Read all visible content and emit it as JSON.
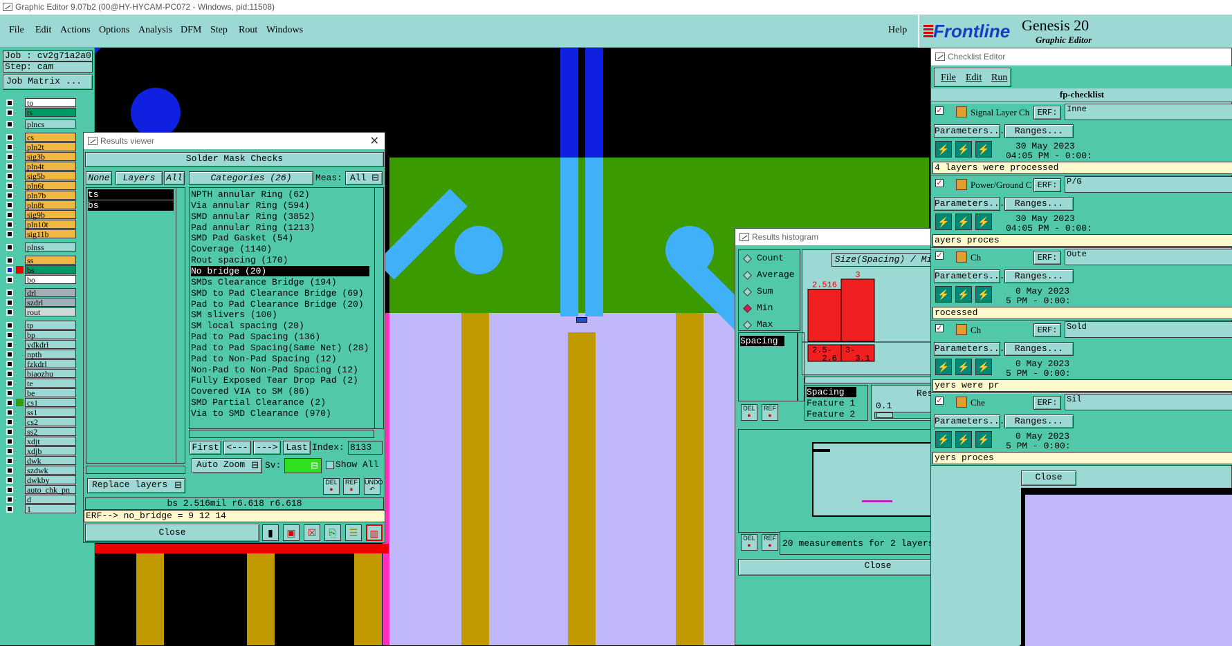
{
  "titlebar": {
    "text": "Graphic Editor 9.07b2 (00@HY-HYCAM-PC072 - Windows, pid:11508)"
  },
  "menu": {
    "items": [
      "File",
      "Edit",
      "Actions",
      "Options",
      "Analysis",
      "DFM",
      "Step",
      "Rout",
      "Windows"
    ],
    "help": "Help"
  },
  "logo": {
    "brand": "Frontline",
    "product": "Genesis 20",
    "subtitle": "Graphic Editor"
  },
  "left": {
    "job": "Job : cv2g71a2a0",
    "step": "Step: cam",
    "job_matrix": "Job Matrix ...",
    "layers": [
      {
        "name": "to",
        "color": "#ffffff"
      },
      {
        "name": "ts",
        "color": "#009966"
      },
      {
        "name": "plncs",
        "color": "#9cd8d4"
      },
      {
        "name": "cs",
        "color": "#f0b840"
      },
      {
        "name": "pln2t",
        "color": "#f0b840"
      },
      {
        "name": "sig3b",
        "color": "#f0b840"
      },
      {
        "name": "pln4t",
        "color": "#f0b840"
      },
      {
        "name": "sig5b",
        "color": "#f0b840"
      },
      {
        "name": "pln6t",
        "color": "#f0b840"
      },
      {
        "name": "pln7b",
        "color": "#f0b840"
      },
      {
        "name": "pln8t",
        "color": "#f0b840"
      },
      {
        "name": "sig9b",
        "color": "#f0b840"
      },
      {
        "name": "pln10t",
        "color": "#f0b840"
      },
      {
        "name": "sig11b",
        "color": "#f0b840"
      },
      {
        "name": "plnss",
        "color": "#9cd8d4"
      },
      {
        "name": "ss",
        "color": "#f0b840"
      },
      {
        "name": "bs",
        "color": "#009966"
      },
      {
        "name": "bo",
        "color": "#ffffff"
      },
      {
        "name": "drl",
        "color": "#a0b0b8"
      },
      {
        "name": "szdrl",
        "color": "#a0b0b8"
      },
      {
        "name": "rout",
        "color": "#d0d8d8"
      },
      {
        "name": "tp",
        "color": "#9cd8d4"
      },
      {
        "name": "bp",
        "color": "#9cd8d4"
      },
      {
        "name": "ydkdrl",
        "color": "#9cd8d4"
      },
      {
        "name": "npth",
        "color": "#9cd8d4"
      },
      {
        "name": "fzkdrl",
        "color": "#9cd8d4"
      },
      {
        "name": "biaozhu",
        "color": "#9cd8d4"
      },
      {
        "name": "te",
        "color": "#9cd8d4"
      },
      {
        "name": "be",
        "color": "#9cd8d4"
      },
      {
        "name": "cs1",
        "color": "#9cd8d4"
      },
      {
        "name": "ss1",
        "color": "#9cd8d4"
      },
      {
        "name": "cs2",
        "color": "#9cd8d4"
      },
      {
        "name": "ss2",
        "color": "#9cd8d4"
      },
      {
        "name": "xdjt",
        "color": "#9cd8d4"
      },
      {
        "name": "xdjb",
        "color": "#9cd8d4"
      },
      {
        "name": "dwk",
        "color": "#9cd8d4"
      },
      {
        "name": "szdwk",
        "color": "#9cd8d4"
      },
      {
        "name": "dwkby",
        "color": "#9cd8d4"
      },
      {
        "name": "auto_chk_pn",
        "color": "#9cd8d4"
      },
      {
        "name": "d",
        "color": "#9cd8d4"
      },
      {
        "name": "1",
        "color": "#9cd8d4"
      }
    ]
  },
  "results_viewer": {
    "title": "Results viewer",
    "header": "Solder Mask Checks",
    "none": "None",
    "layers": "Layers",
    "all": "All",
    "categories": "Categories (26)",
    "meas_label": "Meas:",
    "meas_value": "All",
    "layer_list": [
      "ts",
      "bs"
    ],
    "category_list": [
      "NPTH annular Ring (62)",
      "Via annular Ring (594)",
      "SMD annular Ring (3852)",
      "Pad annular Ring (1213)",
      "SMD Pad Gasket (54)",
      "Coverage (1140)",
      "Rout spacing (170)",
      "No bridge (20)",
      "SMDs Clearance Bridge (194)",
      "SMD to Pad Clearance Bridge (69)",
      "Pad to Pad Clearance Bridge (20)",
      "SM slivers (100)",
      "SM local spacing (20)",
      "Pad to Pad Spacing (136)",
      "Pad to Pad Spacing(Same Net) (28)",
      "Pad to Non-Pad Spacing (12)",
      "Non-Pad to Non-Pad Spacing (12)",
      "Fully Exposed Tear Drop Pad (2)",
      "Covered VIA to SM (86)",
      "SMD Partial Clearance (2)",
      "Via to SMD Clearance (970)"
    ],
    "first": "First",
    "prev": "<---",
    "next": "--->",
    "last": "Last",
    "index_label": "Index:",
    "index_value": "8133",
    "auto_zoom": "Auto Zoom",
    "sv_label": "Sv:",
    "show_all": "Show All",
    "replace_layers": "Replace layers",
    "status": "bs 2.516mil  r6.618  r6.618",
    "erf": "ERF--> no_bridge = 9 12 14",
    "close": "Close",
    "del": "DEL",
    "ref": "REF",
    "undo": "UNDO"
  },
  "histogram": {
    "title": "Results histogram",
    "options": [
      "Count",
      "Average",
      "Sum",
      "Min",
      "Max"
    ],
    "selected_option": "Min",
    "heading": "Size(Spacing) / Min(Spacing)",
    "list_item": "Spacing",
    "axis_list": [
      "Spacing",
      "Feature 1",
      "Feature 2"
    ],
    "resolution_label": "Resolution",
    "resolution_value": "0.1",
    "measurements": "20 measurements for 2 layers",
    "close": "Close",
    "del": "DEL",
    "ref": "REF"
  },
  "chart_data": {
    "type": "bar",
    "categories": [
      "2.5-2.6",
      "3-3.1"
    ],
    "values": [
      2.516,
      3
    ],
    "value_labels": [
      "2.516",
      "3"
    ],
    "title": "Size(Spacing) / Min(Spacing)"
  },
  "checklist": {
    "title": "Checklist Editor",
    "menu": [
      "File",
      "Edit",
      "Run"
    ],
    "name": "fp-checklist",
    "erf": "ERF:",
    "params": "Parameters...",
    "ranges": "Ranges...",
    "close": "Close",
    "items": [
      {
        "name": "Signal Layer Ch",
        "erf_value": "Inne",
        "date": "30 May 2023",
        "time": "04:05 PM - 0:00:",
        "msg": "4 layers were processed"
      },
      {
        "name": "Power/Ground C",
        "erf_value": "P/G",
        "date": "30 May 2023",
        "time": "04:05 PM - 0:00:",
        "msg": "ayers proces"
      },
      {
        "name": "Ch",
        "erf_value": "Oute",
        "date": "0 May 2023",
        "time": "5 PM - 0:00:",
        "msg": "rocessed"
      },
      {
        "name": "Ch",
        "erf_value": "Sold",
        "date": "0 May 2023",
        "time": "5 PM - 0:00:",
        "msg": "yers were pr"
      },
      {
        "name": "Che",
        "erf_value": "Sil",
        "date": "0 May 2023",
        "time": "5 PM - 0:00:",
        "msg": "yers proces"
      }
    ]
  }
}
